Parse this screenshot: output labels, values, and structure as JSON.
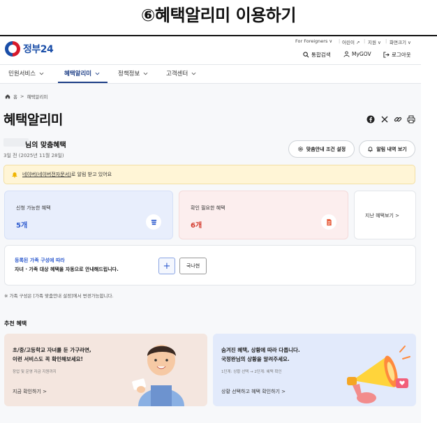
{
  "page_heading": "⑥혜택알리미 이용하기",
  "header": {
    "logo_text": "정부24",
    "utility_links": [
      "For Foreigners ∨",
      "어린이 ↗",
      "지원 ∨",
      "화면크기 ∨"
    ],
    "actions": [
      {
        "label": "통합검색",
        "icon": "search-icon"
      },
      {
        "label": "MyGOV",
        "icon": "user-icon"
      },
      {
        "label": "로그아웃",
        "icon": "logout-icon"
      }
    ]
  },
  "gnb": {
    "items": [
      {
        "label": "민원서비스",
        "active": false
      },
      {
        "label": "혜택알리미",
        "active": true
      },
      {
        "label": "정책정보",
        "active": false
      },
      {
        "label": "고객센터",
        "active": false
      }
    ]
  },
  "breadcrumb": {
    "home": "홈",
    "current": "혜택알리미"
  },
  "title": "혜택알리미",
  "share_icons": [
    "facebook-icon",
    "x-icon",
    "link-icon",
    "print-icon"
  ],
  "benefit": {
    "owner_suffix": "님의 맞춤혜택",
    "date": "3일 전 (2025년 11월 28일)"
  },
  "buttons": {
    "settings": "맞춤안내 조건 설정",
    "alerts": "알림 내역 보기"
  },
  "notice": {
    "link_text": "네이버(네이버전자문서)",
    "text": "로 알림 받고 있어요"
  },
  "cards": {
    "available": {
      "label": "신청 가능한 혜택",
      "count": "5개",
      "icon": "stack-icon"
    },
    "check": {
      "label": "확인 필요한 혜택",
      "count": "6개",
      "icon": "document-icon"
    },
    "past": {
      "label": "지난 혜택보기  >"
    }
  },
  "family": {
    "title": "등록된 가족 구성에 따라",
    "desc": "자녀 · 가족 대상 혜택을 자동으로 안내해드립니다.",
    "add": "+",
    "member": "국나현",
    "note": "※ 가족 구성은 [가족 맞춤안내 설정]에서 변경가능합니다."
  },
  "recommend": {
    "heading": "추천 혜택",
    "left": {
      "title1": "초/중/고등학교 자녀를 둔 가구라면,",
      "title2": "이런 서비스도 꼭 확인해보세요!",
      "sub": "장업 및 운영 자금 지원까지",
      "link": "지금 확인하기  >"
    },
    "right": {
      "title1": "숨겨진 혜택, 상황에 따라 다릅니다.",
      "title2": "국정완님의 상황을 알려주세요.",
      "sub": "1단계: 상황 선택 → 2단계: 혜택 확인",
      "link": "상황 선택하고 혜택 확인하기  >"
    }
  },
  "colors": {
    "brand_blue": "#1d3e86",
    "accent_blue": "#2f5ccf",
    "accent_red": "#d33a2c",
    "notice_bg": "#fff5d6"
  }
}
